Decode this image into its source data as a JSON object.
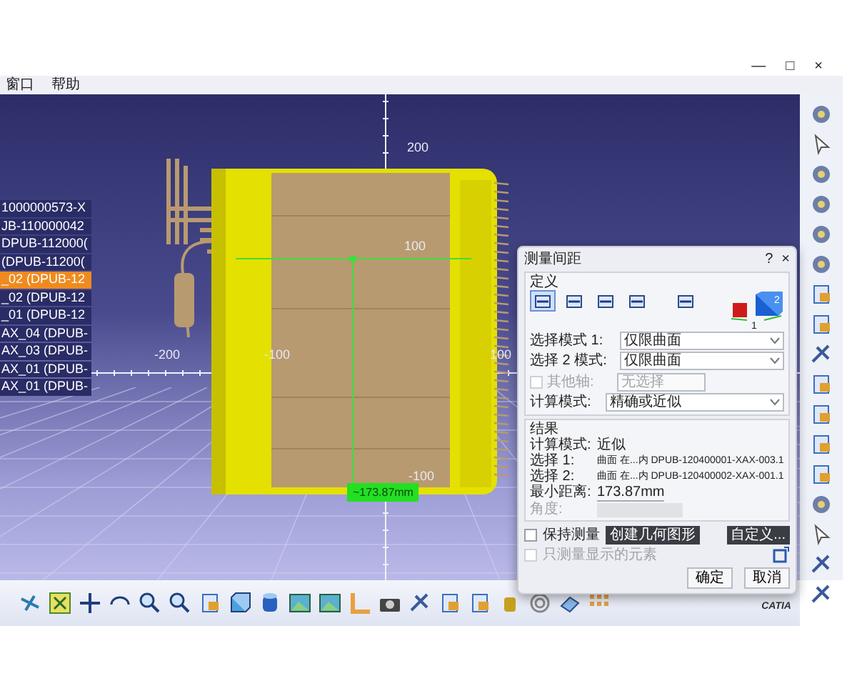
{
  "window": {
    "controls": [
      "—",
      "□",
      "×"
    ]
  },
  "menu": [
    {
      "label": "窗口"
    },
    {
      "label": "帮助"
    }
  ],
  "tree": {
    "items": [
      {
        "label": "1000000573-X",
        "selected": false
      },
      {
        "label": "JB-110000042",
        "selected": false
      },
      {
        "label": "DPUB-112000(",
        "selected": false
      },
      {
        "label": "(DPUB-11200(",
        "selected": false
      },
      {
        "label": "_02 (DPUB-12",
        "selected": true
      },
      {
        "label": "_02 (DPUB-12",
        "selected": false
      },
      {
        "label": "_01 (DPUB-12",
        "selected": false
      },
      {
        "label": "AX_04 (DPUB-",
        "selected": false
      },
      {
        "label": "AX_03 (DPUB-",
        "selected": false
      },
      {
        "label": "AX_01 (DPUB-",
        "selected": false
      },
      {
        "label": "AX_01 (DPUB-",
        "selected": false
      }
    ]
  },
  "viewport": {
    "axis_labels": [
      {
        "text": "200",
        "kind": "v_top"
      },
      {
        "text": "100",
        "kind": "v_mid"
      },
      {
        "text": "-200",
        "kind": "h_far_left"
      },
      {
        "text": "-100",
        "kind": "h_left"
      },
      {
        "text": "100",
        "kind": "h_right"
      },
      {
        "text": "-100",
        "kind": "v_bottom"
      }
    ],
    "measurement_label": "~173.87mm"
  },
  "dialog": {
    "title": "测量间距",
    "help": "?",
    "close": "×",
    "definition": {
      "legend": "定义",
      "mode_buttons": [
        {
          "selected": true
        },
        {
          "selected": false
        },
        {
          "selected": false
        },
        {
          "selected": false
        },
        {
          "selected": false
        }
      ],
      "illustration_labels": [
        "2",
        "1"
      ],
      "mode1_label": "选择模式 1:",
      "mode1_value": "仅限曲面",
      "mode2_label": "选择 2 模式:",
      "mode2_value": "仅限曲面",
      "other_axis": {
        "label": "其他轴:",
        "checked": false,
        "disabled": true,
        "placeholder": "无选择"
      },
      "calc_label": "计算模式:",
      "calc_value": "精确或近似"
    },
    "results": {
      "legend": "结果",
      "rows": [
        {
          "label": "计算模式:",
          "value": "近似"
        },
        {
          "label": "选择 1:",
          "value": "曲面 在...内 DPUB-120400001-XAX-003.1"
        },
        {
          "label": "选择 2:",
          "value": "曲面 在...内 DPUB-120400002-XAX-001.1"
        },
        {
          "label": "最小距离:",
          "value": "173.87mm"
        }
      ],
      "angle": {
        "label": "角度:",
        "disabled": true
      }
    },
    "keep_measure": {
      "label": "保持测量",
      "checked": false
    },
    "create_geometry": "创建几何图形",
    "customize": "自定义...",
    "only_displayed": {
      "label": "只测量显示的元素",
      "checked": false,
      "disabled": true
    },
    "ok": "确定",
    "cancel": "取消"
  },
  "logo_text": "CATIA"
}
